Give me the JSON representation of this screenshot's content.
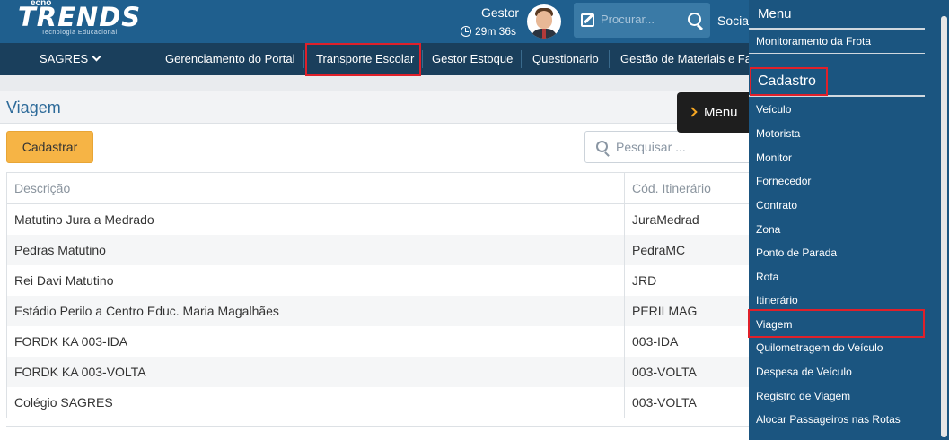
{
  "header": {
    "logo_main": "TRENDS",
    "logo_top": "ecno",
    "logo_sub": "Tecnologia Educacional",
    "user_name": "Gestor",
    "session_timer": "29m 36s",
    "search_placeholder": "Procurar...",
    "social_label": "Social"
  },
  "nav": {
    "brand": "SAGRES",
    "items": [
      {
        "label": "Gerenciamento do Portal"
      },
      {
        "label": "Transporte Escolar"
      },
      {
        "label": "Gestor Estoque"
      },
      {
        "label": "Questionario"
      },
      {
        "label": "Gestão de Materiais e Far"
      }
    ]
  },
  "page": {
    "title": "Viagem",
    "add_button": "Cadastrar",
    "search_placeholder": "Pesquisar ..."
  },
  "table": {
    "columns": [
      "Descrição",
      "Cód. Itinerário"
    ],
    "rows": [
      [
        "Matutino Jura a Medrado",
        "JuraMedrad"
      ],
      [
        "Pedras Matutino",
        "PedraMC"
      ],
      [
        "Rei Davi Matutino",
        "JRD"
      ],
      [
        "Estádio Perilo a Centro Educ. Maria Magalhães",
        "PERILMAG"
      ],
      [
        "FORDK KA 003-IDA",
        "003-IDA"
      ],
      [
        "FORDK KA 003-VOLTA",
        "003-VOLTA"
      ],
      [
        "Colégio SAGRES",
        "003-VOLTA"
      ]
    ]
  },
  "menu_tab": {
    "label": "Menu"
  },
  "sidebar": {
    "title": "Menu",
    "top_item": "Monitoramento da Frota",
    "section": "Cadastro",
    "items": [
      "Veículo",
      "Motorista",
      "Monitor",
      "Fornecedor",
      "Contrato",
      "Zona",
      "Ponto de Parada",
      "Rota",
      "Itinerário",
      "Viagem",
      "Quilometragem do Veículo",
      "Despesa de Veículo",
      "Registro de Viagem",
      "Alocar Passageiros nas Rotas"
    ]
  },
  "colors": {
    "header_bg": "#1f5f8e",
    "nav_bg": "#1a3f5c",
    "sidebar_bg": "#1b5580",
    "accent_button": "#f6b445",
    "highlight": "#e0202a"
  }
}
